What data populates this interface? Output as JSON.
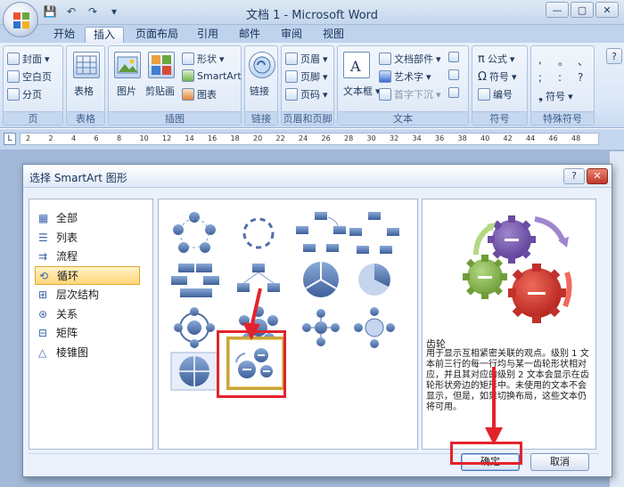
{
  "window": {
    "title": "文档 1 - Microsoft Word"
  },
  "qat": {
    "save": "save-icon",
    "undo": "undo-icon",
    "redo": "redo-icon"
  },
  "tabs": [
    {
      "label": "开始"
    },
    {
      "label": "插入"
    },
    {
      "label": "页面布局"
    },
    {
      "label": "引用"
    },
    {
      "label": "邮件"
    },
    {
      "label": "审阅"
    },
    {
      "label": "视图"
    }
  ],
  "active_tab": "插入",
  "ribbon": {
    "pages": {
      "label": "页",
      "items": [
        "封面",
        "空白页",
        "分页"
      ]
    },
    "tables": {
      "label": "表格",
      "button": "表格"
    },
    "illustrations": {
      "label": "插图",
      "picture": "图片",
      "clipart": "剪贴画",
      "shapes": "形状",
      "smartart": "SmartArt",
      "chart": "图表"
    },
    "links": {
      "label": "链接",
      "button": "链接"
    },
    "header_footer": {
      "label": "页眉和页脚",
      "items": [
        "页眉",
        "页脚",
        "页码"
      ]
    },
    "text": {
      "label": "文本",
      "textbox": "文本框",
      "quickparts": "文档部件",
      "wordart": "艺术字",
      "dropcap": "首字下沉"
    },
    "symbols": {
      "label": "符号",
      "items": [
        "公式",
        "符号",
        "编号"
      ]
    },
    "special": {
      "label": "特殊符号",
      "symbols": [
        ",",
        "。",
        "、",
        ";",
        ":",
        "?"
      ],
      "dropdown": "符号"
    }
  },
  "ruler": {
    "numbers": [
      "2",
      "2",
      "4",
      "6",
      "8",
      "10",
      "12",
      "14",
      "16",
      "18",
      "20",
      "22",
      "24",
      "26",
      "28",
      "30",
      "32",
      "34",
      "36",
      "38",
      "40",
      "42",
      "44",
      "46",
      "48"
    ]
  },
  "dialog": {
    "title": "选择 SmartArt 图形",
    "help": "?",
    "close": "✕",
    "categories": [
      {
        "label": "全部",
        "icon": "all-icon"
      },
      {
        "label": "列表",
        "icon": "list-icon"
      },
      {
        "label": "流程",
        "icon": "process-icon"
      },
      {
        "label": "循环",
        "icon": "cycle-icon",
        "selected": true
      },
      {
        "label": "层次结构",
        "icon": "hierarchy-icon"
      },
      {
        "label": "关系",
        "icon": "relationship-icon"
      },
      {
        "label": "矩阵",
        "icon": "matrix-icon"
      },
      {
        "label": "棱锥图",
        "icon": "pyramid-icon"
      }
    ],
    "preview": {
      "title": "齿轮",
      "description": "用于显示互相紧密关联的观点。级别 1 文本前三行的每一行均与某一齿轮形状相对应，并且其对应的级别 2 文本会显示在齿轮形状旁边的矩形中。未使用的文本不会显示，但是，如果切换布局，这些文本仍将可用。"
    },
    "ok": "确定",
    "cancel": "取消"
  },
  "colors": {
    "ribbon_bg": "#dbe7f7",
    "selected_category": "#ffd679",
    "annotation_red": "#e3232c",
    "gear_blue": "#4f6fa8",
    "gear_purple": "#7b57b0",
    "gear_red": "#d9342e",
    "gear_green": "#8ab84f"
  }
}
